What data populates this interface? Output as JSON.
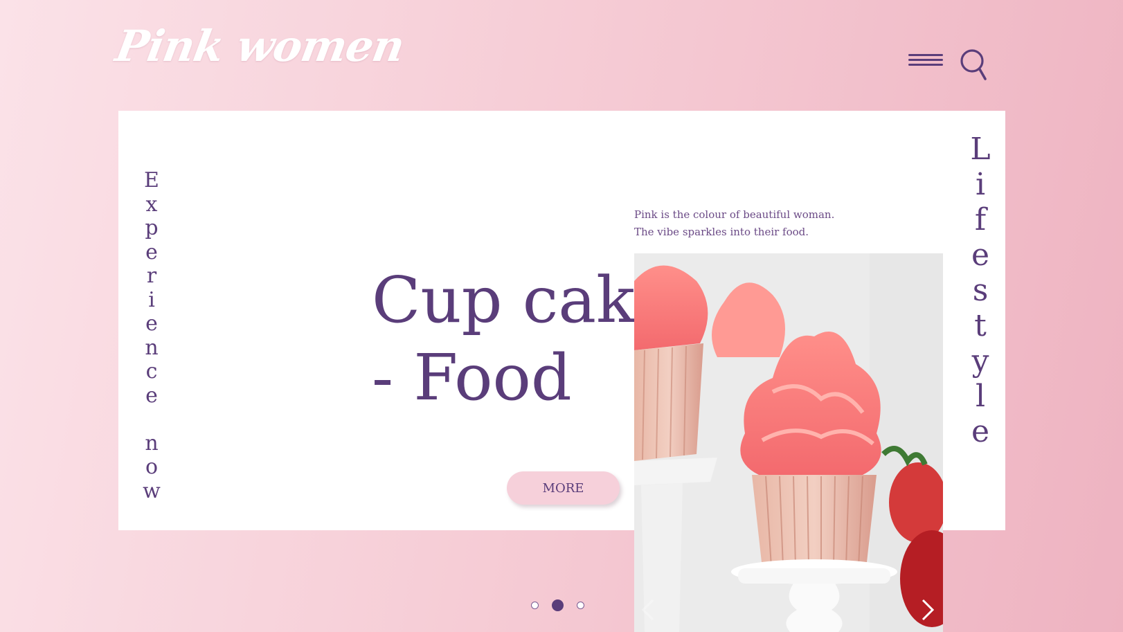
{
  "header": {
    "logo_text": "Pink women",
    "menu_icon": "hamburger-menu-icon",
    "search_icon": "search-icon"
  },
  "hero": {
    "left_vertical_text": "Experience now",
    "right_vertical_text": "Lifestyle",
    "tagline_line1": "Pink is the colour of beautiful woman.",
    "tagline_line2": "The vibe sparkles into their food.",
    "headline_line1": "Cup cakes",
    "headline_line2": "- Food",
    "more_label": "MORE",
    "image_subject": "pink frosted cupcakes on white stands"
  },
  "slider": {
    "slide_count": 3,
    "active_index": 1,
    "prev_icon": "chevron-left-icon",
    "next_icon": "chevron-right-icon"
  },
  "colors": {
    "accent": "#5a3d7a",
    "button_bg": "#f6d0da",
    "background_start": "#fbe2e8",
    "background_end": "#eeb3c1"
  }
}
